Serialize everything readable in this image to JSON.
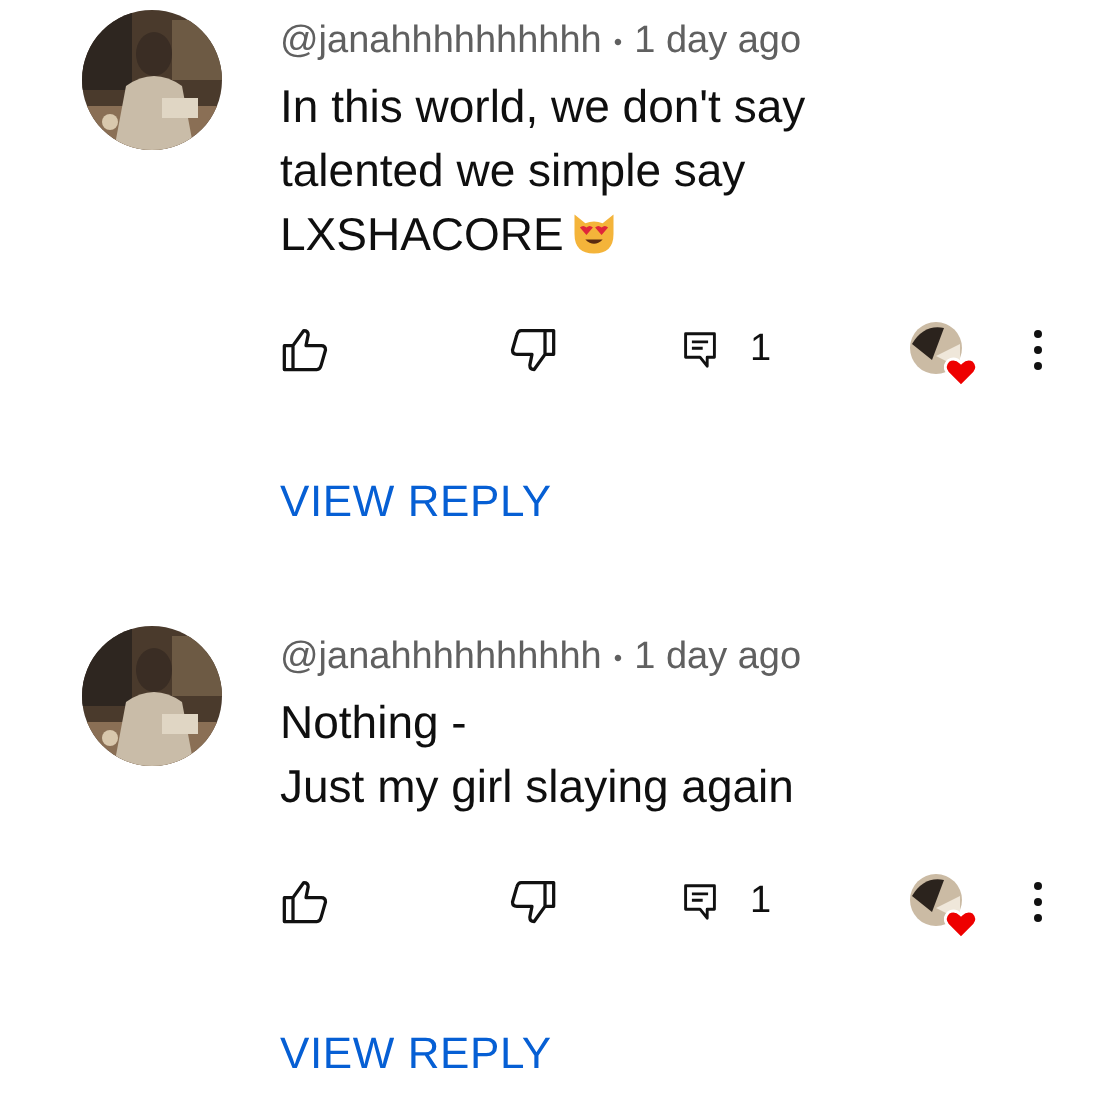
{
  "comments": [
    {
      "author": "@janahhhhhhhhhh",
      "separator": "•",
      "time": "1 day ago",
      "lines": [
        "In this world, we don't say",
        "talented we simple say",
        "LXSHACORE"
      ],
      "ends_with_emoji": true,
      "reply_count": "1",
      "hearted": true,
      "view_reply": "VIEW REPLY"
    },
    {
      "author": "@janahhhhhhhhhh",
      "separator": "•",
      "time": "1 day ago",
      "lines": [
        "Nothing -",
        "Just my girl slaying again"
      ],
      "ends_with_emoji": false,
      "reply_count": "1",
      "hearted": true,
      "view_reply": "VIEW REPLY"
    }
  ]
}
